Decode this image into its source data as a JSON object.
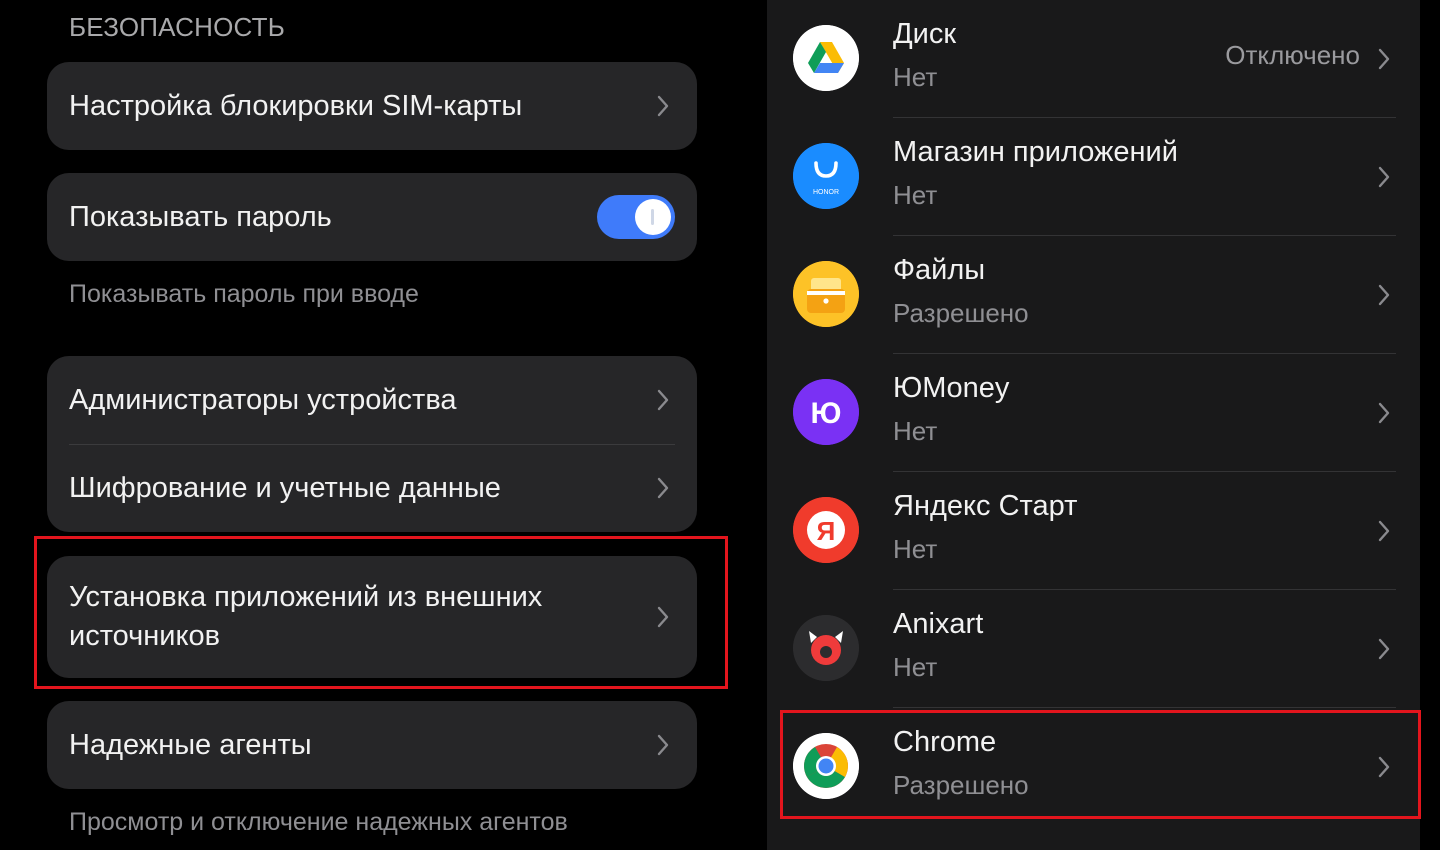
{
  "left": {
    "section_title": "БЕЗОПАСНОСТЬ",
    "items": {
      "sim_lock": "Настройка блокировки SIM-карты",
      "show_password": "Показывать пароль",
      "show_password_desc": "Показывать пароль при вводе",
      "device_admins": "Администраторы устройства",
      "encryption": "Шифрование и учетные данные",
      "install_unknown_line1": "Установка приложений из внешних",
      "install_unknown_line2": "источников",
      "trust_agents": "Надежные агенты",
      "trust_agents_desc": "Просмотр и отключение надежных агентов"
    },
    "show_password_enabled": true
  },
  "right": {
    "apps": [
      {
        "name": "Диск",
        "status": "Нет",
        "extra": "Отключено",
        "icon": "google-drive-icon"
      },
      {
        "name": "Магазин приложений",
        "status": "Нет",
        "icon": "honor-app-store-icon",
        "icon_text": "HONOR"
      },
      {
        "name": "Файлы",
        "status": "Разрешено",
        "icon": "files-icon"
      },
      {
        "name": "ЮMoney",
        "status": "Нет",
        "icon": "yoomoney-icon",
        "icon_text": "Ю"
      },
      {
        "name": "Яндекс Старт",
        "status": "Нет",
        "icon": "yandex-start-icon",
        "icon_text": "Я"
      },
      {
        "name": "Anixart",
        "status": "Нет",
        "icon": "anixart-icon"
      },
      {
        "name": "Chrome",
        "status": "Разрешено",
        "icon": "chrome-icon"
      }
    ]
  },
  "colors": {
    "accent_toggle": "#3f7bfa",
    "highlight_box": "#e3151d",
    "card_bg": "#262628",
    "right_bg": "#19191a"
  }
}
